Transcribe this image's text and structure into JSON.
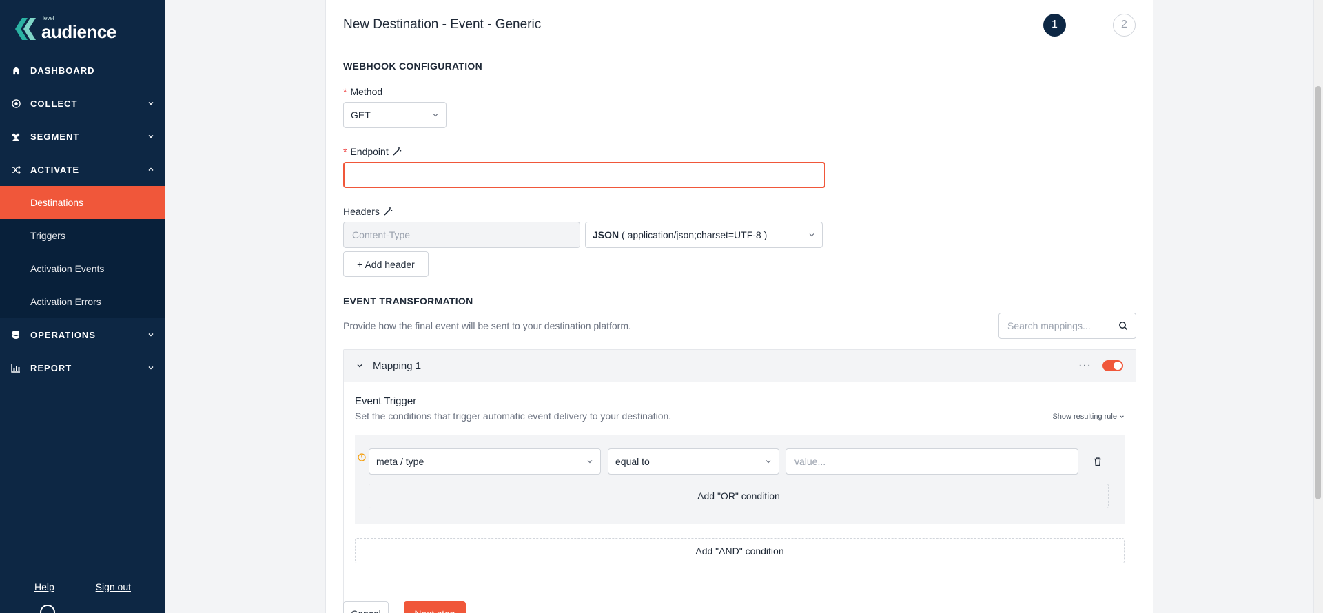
{
  "brand": {
    "small": "level",
    "name": "audience"
  },
  "sidebar": {
    "items": [
      {
        "label": "DASHBOARD",
        "icon": "home-icon"
      },
      {
        "label": "COLLECT",
        "icon": "collect-icon"
      },
      {
        "label": "SEGMENT",
        "icon": "users-icon"
      },
      {
        "label": "ACTIVATE",
        "icon": "shuffle-icon"
      },
      {
        "label": "OPERATIONS",
        "icon": "database-icon"
      },
      {
        "label": "REPORT",
        "icon": "bar-chart-icon"
      }
    ],
    "activate_sub": [
      "Destinations",
      "Triggers",
      "Activation Events",
      "Activation Errors"
    ],
    "footer": {
      "help": "Help",
      "signout": "Sign out"
    }
  },
  "header": {
    "title": "New Destination - Event - Generic",
    "step1": "1",
    "step2": "2"
  },
  "webhook": {
    "section_title": "WEBHOOK CONFIGURATION",
    "method_label": "Method",
    "method_value": "GET",
    "endpoint_label": "Endpoint",
    "endpoint_value": "",
    "headers_label": "Headers",
    "header_key_placeholder": "Content-Type",
    "header_value_bold": "JSON",
    "header_value_rest": "( application/json;charset=UTF-8 )",
    "add_header": "+ Add header"
  },
  "transform": {
    "section_title": "EVENT TRANSFORMATION",
    "description": "Provide how the final event will be sent to your destination platform.",
    "search_placeholder": "Search mappings...",
    "mapping_title": "Mapping 1",
    "more": "···",
    "trigger_title": "Event Trigger",
    "trigger_desc": "Set the conditions that trigger automatic event delivery to your destination.",
    "show_rule": "Show resulting rule",
    "field_value": "meta / type",
    "operator_value": "equal to",
    "value_placeholder": "value...",
    "add_or": "Add \"OR\" condition",
    "add_and": "Add \"AND\" condition"
  },
  "footer": {
    "cancel": "Cancel",
    "next": "Next step"
  },
  "colors": {
    "sidebar": "#0d2744",
    "accent": "#f0573a"
  }
}
